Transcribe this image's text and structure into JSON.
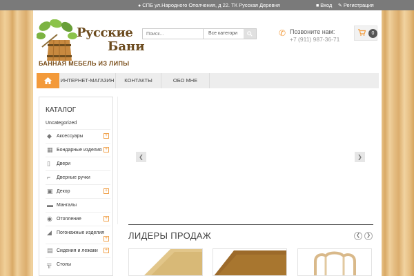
{
  "topbar": {
    "address_icon": "location-pin-icon",
    "address": "СПБ ул.Народного Ополчения, д 22. ТК Русская Деревня",
    "login_icon": "user-icon",
    "login": "Вход",
    "register_icon": "pencil-icon",
    "register": "Регистрация"
  },
  "logo": {
    "line1": "Русские",
    "line2": "Бани",
    "slogan": "БАННАЯ МЕБЕЛЬ ИЗ ЛИПЫ"
  },
  "search": {
    "placeholder": "Поиск...",
    "category": "Все категори",
    "button_icon": "search-icon"
  },
  "phone": {
    "label": "Позвоните нам:",
    "number": "+7 (911) 987-36-71"
  },
  "cart": {
    "icon": "cart-icon",
    "count": "0"
  },
  "nav": {
    "home_icon": "home-icon",
    "items": [
      "ИНТЕРНЕТ-МАГАЗИН",
      "КОНТАКТЫ",
      "ОБО МНЕ"
    ]
  },
  "sidebar": {
    "title": "КАТАЛОГ",
    "uncategorized": "Uncategorized",
    "items": [
      {
        "label": "Аксессуары",
        "icon": "accessory-icon",
        "expandable": true
      },
      {
        "label": "Бондарные изделия",
        "icon": "barrel-icon",
        "expandable": true
      },
      {
        "label": "Двери",
        "icon": "door-icon",
        "expandable": false
      },
      {
        "label": "Дверные ручки",
        "icon": "door-handle-icon",
        "expandable": false
      },
      {
        "label": "Декор",
        "icon": "decor-icon",
        "expandable": true
      },
      {
        "label": "Мангалы",
        "icon": "grill-icon",
        "expandable": false
      },
      {
        "label": "Отопление",
        "icon": "heating-icon",
        "expandable": true
      },
      {
        "label": "Погонажные изделия",
        "icon": "molding-icon",
        "expandable": true
      },
      {
        "label": "Сидения и лежаки",
        "icon": "bench-icon",
        "expandable": true
      },
      {
        "label": "Столы",
        "icon": "table-icon",
        "expandable": false
      }
    ]
  },
  "slider": {
    "prev_icon": "chevron-left-icon",
    "next_icon": "chevron-right-icon"
  },
  "section": {
    "title": "ЛИДЕРЫ ПРОДАЖ",
    "prev_icon": "chevron-left-icon",
    "next_icon": "chevron-right-icon"
  },
  "colors": {
    "accent": "#f39a3a",
    "topbar": "#7a7a7a",
    "logo_brown": "#6b4a1d"
  }
}
